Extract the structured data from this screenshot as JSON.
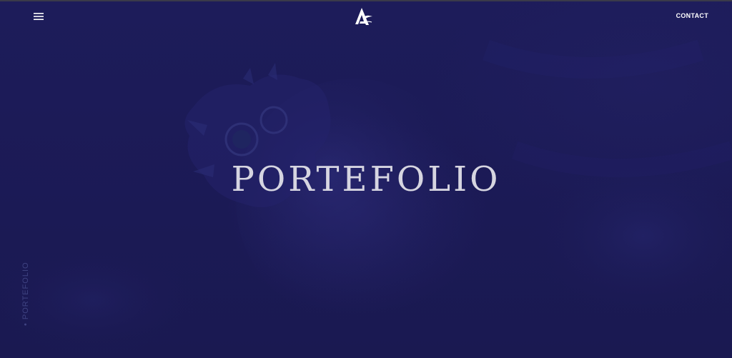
{
  "header": {
    "menu_icon": "hamburger-menu-icon",
    "logo_icon": "stylized-letter-a-logo",
    "contact_label": "CONTACT"
  },
  "hero": {
    "title": "PORTEFOLIO"
  },
  "side_label": {
    "bullet": "•",
    "text": "PORTEFOLIO"
  },
  "colors": {
    "background": "#1b1a55",
    "title": "#e6e5ec",
    "side_label": "#3f4382",
    "header_text": "#ffffff"
  }
}
